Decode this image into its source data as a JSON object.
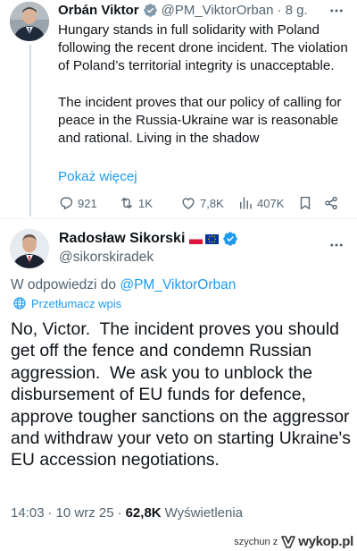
{
  "parent_tweet": {
    "author_name": "Orbán Viktor",
    "handle": "@PM_ViktorOrban",
    "time": "· 8 g.",
    "paragraphs": [
      "Hungary stands in full solidarity with Poland following the recent drone incident. The violation of Poland’s territorial integrity is unacceptable.",
      "The incident proves that our policy of calling for peace in the Russia-Ukraine war is reasonable and rational. Living in the shadow"
    ],
    "show_more": "Pokaż więcej",
    "actions": {
      "replies": "921",
      "reposts": "1K",
      "likes": "7,8K",
      "views": "407K"
    }
  },
  "reply_tweet": {
    "author_name": "Radosław Sikorski",
    "handle": "@sikorskiradek",
    "replying_prefix": "W odpowiedzi do",
    "replying_to": "@PM_ViktorOrban",
    "translate_label": "Przetłumacz wpis",
    "text": "No, Victor.  The incident proves you should get off the fence and condemn Russian aggression.  We ask you to unblock the disbursement of EU funds for defence, approve tougher sanctions on the aggressor and withdraw your veto on starting Ukraine's EU accession negotiations.",
    "time": "14:03",
    "date": "10 wrz 25",
    "views_count": "62,8K",
    "views_label": "Wyświetlenia"
  },
  "watermark": {
    "user": "szychun z",
    "site": "wykop.pl"
  },
  "colors": {
    "accent": "#1d9bf0",
    "secondary_text": "#536471",
    "primary_text": "#0f1419",
    "divider": "#eff3f4"
  }
}
